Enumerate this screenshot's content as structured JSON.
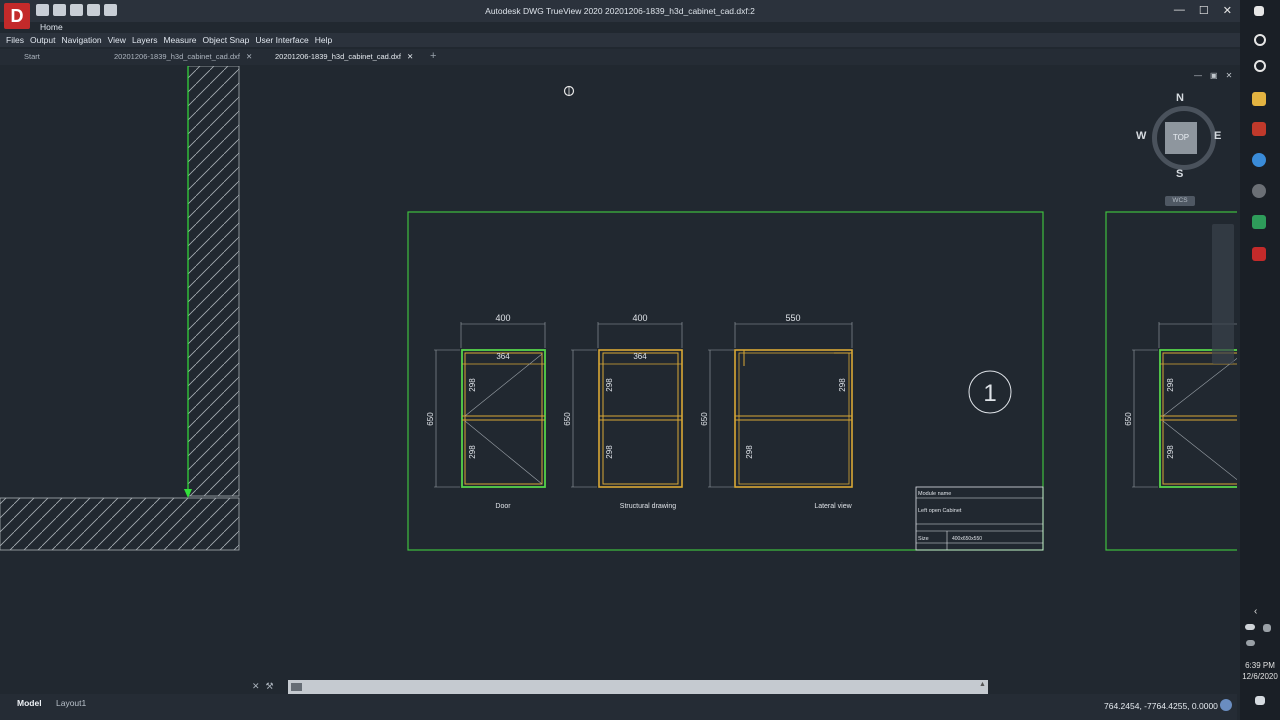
{
  "app": {
    "logo_letter": "D",
    "window_title": "Autodesk DWG TrueView 2020   20201206-1839_h3d_cabinet_cad.dxf:2",
    "home_tab": "Home"
  },
  "window_controls": {
    "minimize": "—",
    "maximize": "☐",
    "close": "✕"
  },
  "menu": [
    "Files",
    "Output",
    "Navigation",
    "View",
    "Layers",
    "Measure",
    "Object Snap",
    "User Interface",
    "Help"
  ],
  "doc_tabs": {
    "start": "Start",
    "tab1": "20201206-1839_h3d_cabinet_cad.dxf",
    "tab2": "20201206-1839_h3d_cabinet_cad.dxf",
    "close": "✕",
    "add": "+"
  },
  "viewport_controls": {
    "minimize": "—",
    "restore": "▣",
    "close": "✕"
  },
  "viewcube": {
    "north": "N",
    "south": "S",
    "east": "E",
    "west": "W",
    "face": "TOP",
    "wcs": "WCS"
  },
  "drawing": {
    "dims": {
      "door_width": "400",
      "struct_width": "400",
      "lateral_width": "550",
      "door_inner": "364",
      "struct_inner": "364",
      "height": "650",
      "half": "298"
    },
    "view_labels": {
      "door": "Door",
      "structural": "Structural drawing",
      "lateral": "Lateral view"
    },
    "section_number": "1",
    "title_block": {
      "module_label": "Module name",
      "module_value": "Left open Cabinet",
      "size_label": "Size",
      "size_value": "400x650x550"
    },
    "colors": {
      "frame": "#3fbf3f",
      "cabinet": "#d9a836",
      "green_inner": "#56d34a",
      "line": "#9aa1a8"
    }
  },
  "command_line": {
    "placeholder": ""
  },
  "layout_tabs": {
    "model": "Model",
    "layout1": "Layout1"
  },
  "status": {
    "coords": "764.2454, -7764.4255, 0.0000"
  },
  "tray": {
    "time": "6:39 PM",
    "date": "12/6/2020"
  }
}
